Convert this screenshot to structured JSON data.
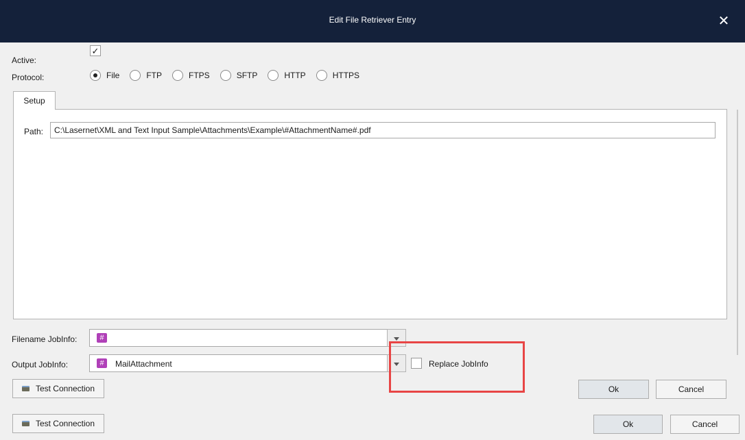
{
  "window": {
    "title": "Edit File Retriever Entry",
    "close_glyph": "✕"
  },
  "active": {
    "label": "Active:",
    "checked": true,
    "check_glyph": "✓"
  },
  "protocol": {
    "label": "Protocol:",
    "options": [
      {
        "label": "File",
        "selected": true
      },
      {
        "label": "FTP",
        "selected": false
      },
      {
        "label": "FTPS",
        "selected": false
      },
      {
        "label": "SFTP",
        "selected": false
      },
      {
        "label": "HTTP",
        "selected": false
      },
      {
        "label": "HTTPS",
        "selected": false
      }
    ]
  },
  "tabs": [
    {
      "label": "Setup",
      "active": true
    }
  ],
  "setup": {
    "path_label": "Path:",
    "path_value": "C:\\Lasernet\\XML and Text Input Sample\\Attachments\\Example\\#AttachmentName#.pdf"
  },
  "filename_jobinfo": {
    "label": "Filename JobInfo:",
    "value": "",
    "icon": "hash-icon"
  },
  "output_jobinfo": {
    "label": "Output JobInfo:",
    "value": "MailAttachment",
    "icon": "hash-icon"
  },
  "replace_jobinfo": {
    "label": "Replace JobInfo",
    "checked": false
  },
  "buttons": {
    "test_connection": "Test Connection",
    "ok": "Ok",
    "cancel": "Cancel"
  },
  "colors": {
    "titlebar": "#14213a",
    "highlight": "#e84545",
    "jobinfo_icon": "#b040b8"
  }
}
